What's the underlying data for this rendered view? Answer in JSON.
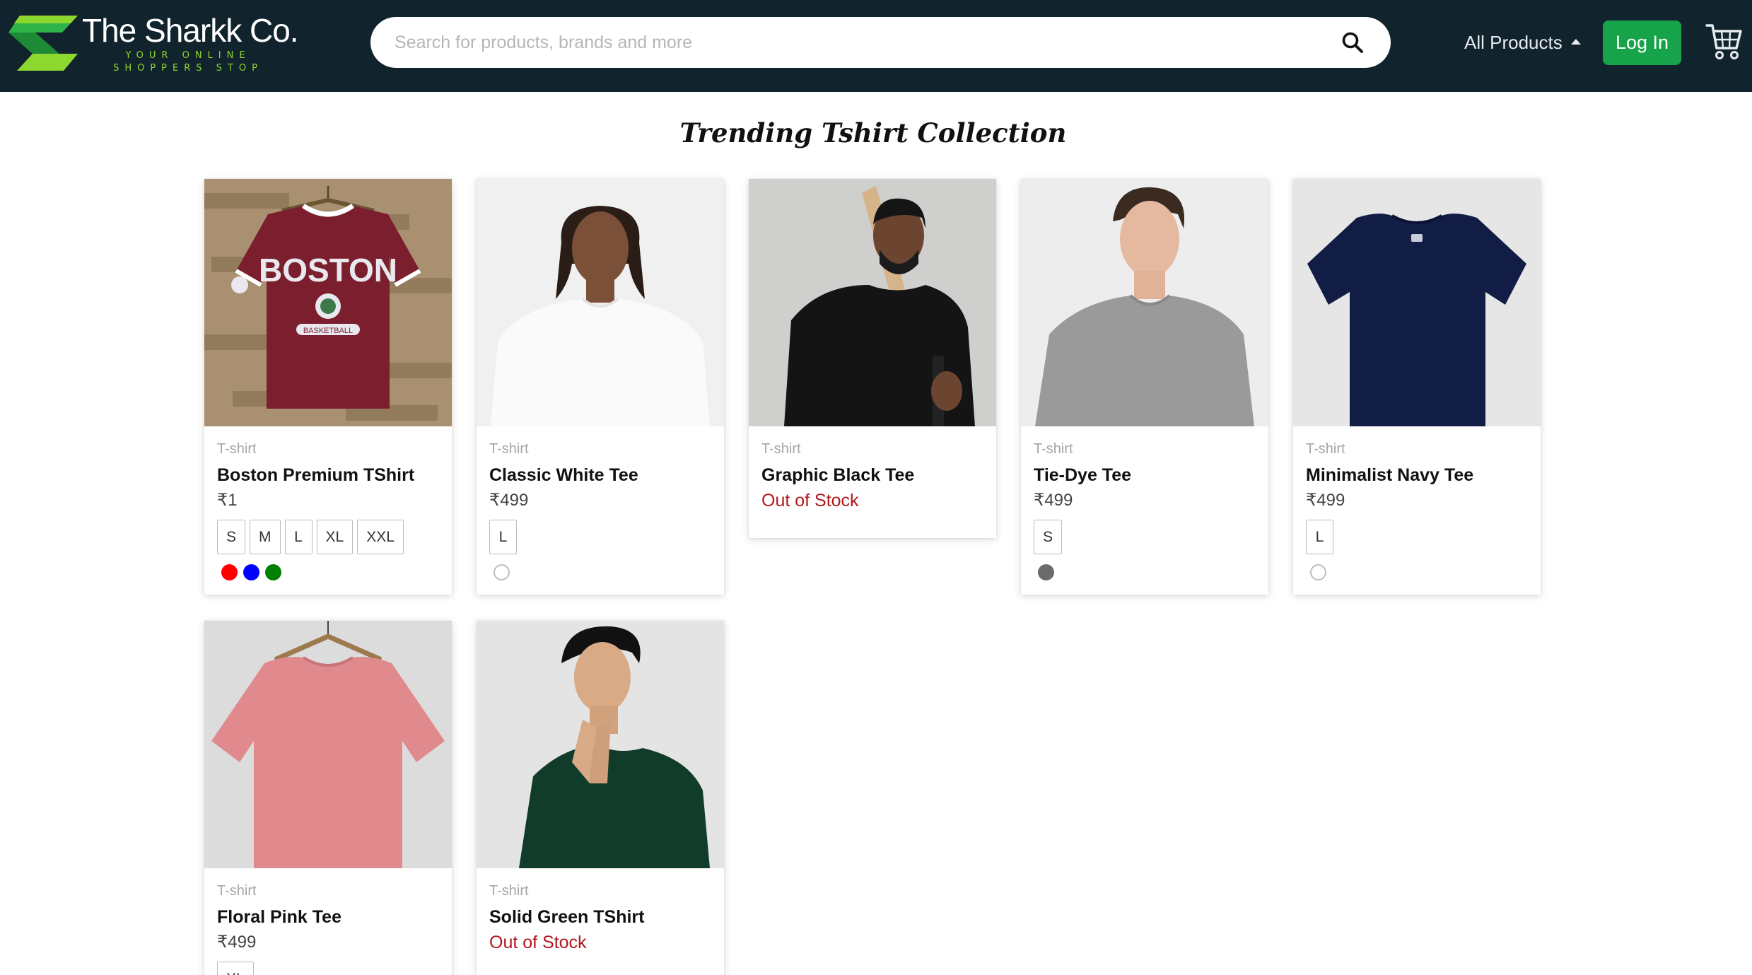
{
  "brand": {
    "name": "The Sharkk Co.",
    "tagline": "YOUR ONLINE SHOPPERS STOP",
    "logo_colors": [
      "#8ed72e",
      "#2fb44a"
    ]
  },
  "search": {
    "placeholder": "Search for products, brands and more",
    "value": "",
    "icon": "search-icon"
  },
  "nav": {
    "all_products_label": "All Products",
    "login_label": "Log In",
    "cart_icon": "cart-icon"
  },
  "page": {
    "heading": "Trending Tshirt Collection"
  },
  "colors": {
    "navbar_bg": "#11232d",
    "login_bg": "#17a34a",
    "out_of_stock": "#b3161c"
  },
  "products": [
    {
      "image": "maroon-boston-tshirt-on-hanger",
      "category": "T-shirt",
      "name": "Boston Premium TShirt",
      "price": "₹1",
      "out_of_stock_label": "",
      "sizes": [
        "S",
        "M",
        "L",
        "XL",
        "XXL"
      ],
      "colors": [
        "#ff0000",
        "#0000ff",
        "#008000"
      ]
    },
    {
      "image": "man-in-white-tshirt",
      "category": "T-shirt",
      "name": "Classic White Tee",
      "price": "₹499",
      "out_of_stock_label": "",
      "sizes": [
        "L"
      ],
      "colors": [
        "#ffffff"
      ]
    },
    {
      "image": "man-in-black-tshirt-with-bat",
      "category": "T-shirt",
      "name": "Graphic Black Tee",
      "price": "",
      "out_of_stock_label": "Out of Stock",
      "sizes": [],
      "colors": []
    },
    {
      "image": "man-in-grey-tshirt",
      "category": "T-shirt",
      "name": "Tie-Dye Tee",
      "price": "₹499",
      "out_of_stock_label": "",
      "sizes": [
        "S"
      ],
      "colors": [
        "#6b6b6b"
      ]
    },
    {
      "image": "navy-tshirt-flat",
      "category": "T-shirt",
      "name": "Minimalist Navy Tee",
      "price": "₹499",
      "out_of_stock_label": "",
      "sizes": [
        "L"
      ],
      "colors": [
        "#ffffff"
      ]
    },
    {
      "image": "pink-tshirt-on-hanger",
      "category": "T-shirt",
      "name": "Floral Pink Tee",
      "price": "₹499",
      "out_of_stock_label": "",
      "sizes": [
        "XL"
      ],
      "colors": []
    },
    {
      "image": "man-in-green-tshirt-praying",
      "category": "T-shirt",
      "name": "Solid Green TShirt",
      "price": "",
      "out_of_stock_label": "Out of Stock",
      "sizes": [],
      "colors": []
    }
  ]
}
